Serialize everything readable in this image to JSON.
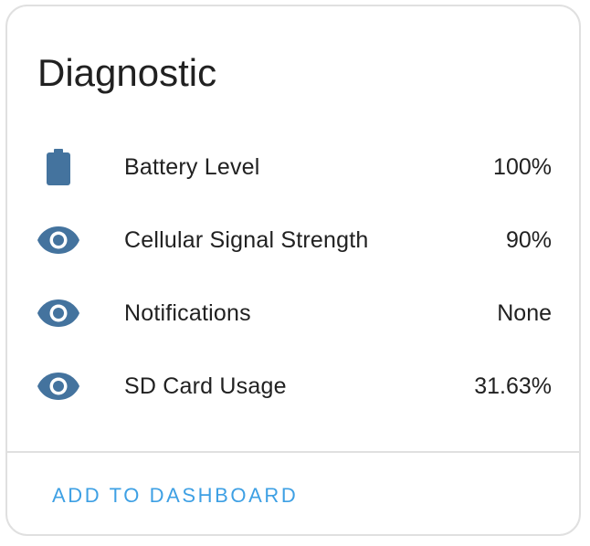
{
  "card": {
    "title": "Diagnostic",
    "entities": [
      {
        "icon": "battery-icon",
        "name": "Battery Level",
        "value": "100%"
      },
      {
        "icon": "eye-icon",
        "name": "Cellular Signal Strength",
        "value": "90%"
      },
      {
        "icon": "eye-icon",
        "name": "Notifications",
        "value": "None"
      },
      {
        "icon": "eye-icon",
        "name": "SD Card Usage",
        "value": "31.63%"
      }
    ],
    "action_label": "ADD TO DASHBOARD"
  },
  "colors": {
    "icon": "#44739e",
    "accent": "#3ea0e4",
    "text": "#212121",
    "divider": "#e0e0e0"
  }
}
